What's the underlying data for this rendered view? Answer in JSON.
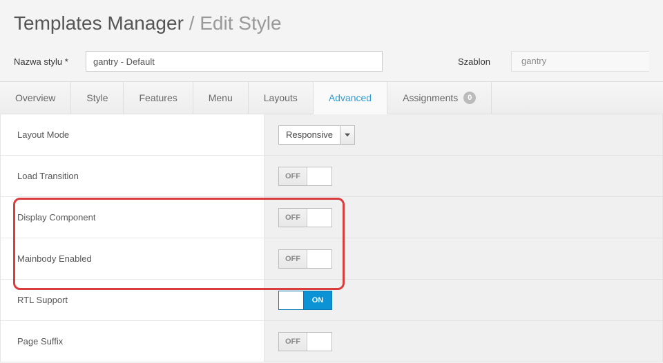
{
  "header": {
    "title": "Templates Manager",
    "subtitle": "/ Edit Style"
  },
  "form": {
    "style_name_label": "Nazwa stylu *",
    "style_name_value": "gantry - Default",
    "template_label": "Szablon",
    "template_value": "gantry"
  },
  "tabs": {
    "overview": "Overview",
    "style": "Style",
    "features": "Features",
    "menu": "Menu",
    "layouts": "Layouts",
    "advanced": "Advanced",
    "assignments": "Assignments",
    "assignments_count": "0"
  },
  "settings": {
    "layout_mode": {
      "label": "Layout Mode",
      "value": "Responsive"
    },
    "load_transition": {
      "label": "Load Transition",
      "state": "OFF"
    },
    "display_component": {
      "label": "Display Component",
      "state": "OFF"
    },
    "mainbody_enabled": {
      "label": "Mainbody Enabled",
      "state": "OFF"
    },
    "rtl_support": {
      "label": "RTL Support",
      "state": "ON"
    },
    "page_suffix": {
      "label": "Page Suffix",
      "state": "OFF"
    }
  }
}
